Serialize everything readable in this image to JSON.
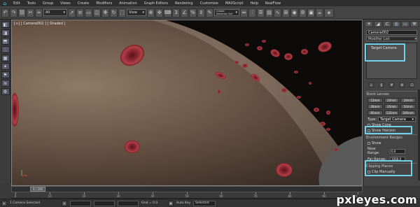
{
  "menu": {
    "items": [
      "Edit",
      "Tools",
      "Group",
      "Views",
      "Create",
      "Modifiers",
      "Animation",
      "Graph Editors",
      "Rendering",
      "Customize",
      "MAXScript",
      "Help",
      "RealFlow"
    ]
  },
  "toolbar": {
    "selection_filter": "All",
    "reference_coord": "View",
    "named_selection": "Create Selection Set"
  },
  "viewport": {
    "label": "[+] [ Camera002 ] [ Shaded ]"
  },
  "command_panel": {
    "object_name": "Camera002",
    "modifier_list": "Modifier List",
    "stack_item": "Target Camera",
    "lens_section": "Stock Lenses",
    "lens_buttons": [
      "15mm",
      "20mm",
      "24mm",
      "28mm",
      "35mm",
      "50mm",
      "85mm",
      "135mm",
      "200mm"
    ],
    "type_label": "Type:",
    "type_value": "Target Camera",
    "show_cone": "Show Cone",
    "show_horizon": "Show Horizon",
    "env_section": "Environment Ranges",
    "show_env": "Show",
    "near_label": "Near Range:",
    "near_value": "0.0",
    "far_label": "Far Range:",
    "far_value": "1000.0",
    "clip_section": "Clipping Planes",
    "clip_manually": "Clip Manually"
  },
  "timeline": {
    "frame_counter": "0 / 100",
    "tick_labels": [
      "0",
      "10",
      "20",
      "30",
      "40",
      "50",
      "60",
      "70",
      "80",
      "90",
      "100"
    ]
  },
  "status": {
    "selection": "1 Camera Selected",
    "grid": "Grid = 0.0",
    "auto_key": "Auto Key",
    "selected": "Selected"
  },
  "watermark": "pxleyes.com",
  "colors": {
    "highlight": "#6fd2e8",
    "cell": "#a8343c"
  }
}
